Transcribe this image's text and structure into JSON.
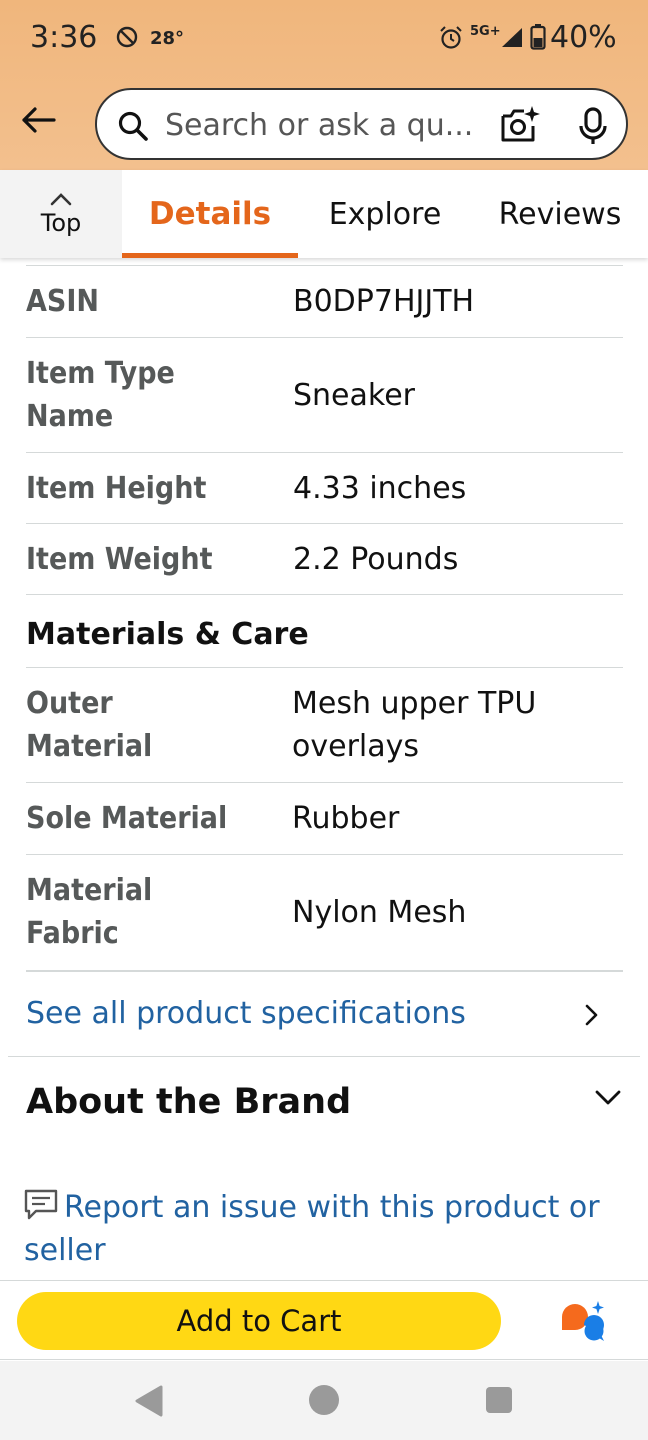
{
  "status_bar": {
    "time": "3:36",
    "temperature": "28°",
    "network": "5G+",
    "battery": "40%"
  },
  "search": {
    "placeholder": "Search or ask a qu...",
    "value": ""
  },
  "tabs": {
    "top_label": "Top",
    "items": [
      {
        "label": "Details",
        "active": true
      },
      {
        "label": "Explore",
        "active": false
      },
      {
        "label": "Reviews",
        "active": false
      }
    ]
  },
  "specs": [
    {
      "label": "ASIN",
      "value": "B0DP7HJJTH"
    },
    {
      "label": "Item Type Name",
      "value": "Sneaker"
    },
    {
      "label": "Item Height",
      "value": "4.33 inches"
    },
    {
      "label": "Item Weight",
      "value": "2.2 Pounds"
    }
  ],
  "materials_section": {
    "title": "Materials & Care",
    "items": [
      {
        "label": "Outer Material",
        "value": "Mesh upper TPU overlays"
      },
      {
        "label": "Sole Material",
        "value": "Rubber"
      },
      {
        "label": "Material Fabric",
        "value": "Nylon Mesh"
      }
    ]
  },
  "links": {
    "see_all": "See all product specifications",
    "about_brand": "About the Brand",
    "report": "Report an issue with this product or seller"
  },
  "bottom_bar": {
    "add_to_cart": "Add to Cart"
  },
  "colors": {
    "header": "#f0b67c",
    "accent": "#e4661b",
    "link": "#2162a1",
    "cart_button": "#ffd814"
  },
  "icons": [
    "back-arrow-icon",
    "search-icon",
    "camera-icon",
    "mic-icon",
    "chevron-up-icon",
    "chevron-right-icon",
    "chevron-down-icon",
    "report-icon",
    "rufus-icon"
  ]
}
